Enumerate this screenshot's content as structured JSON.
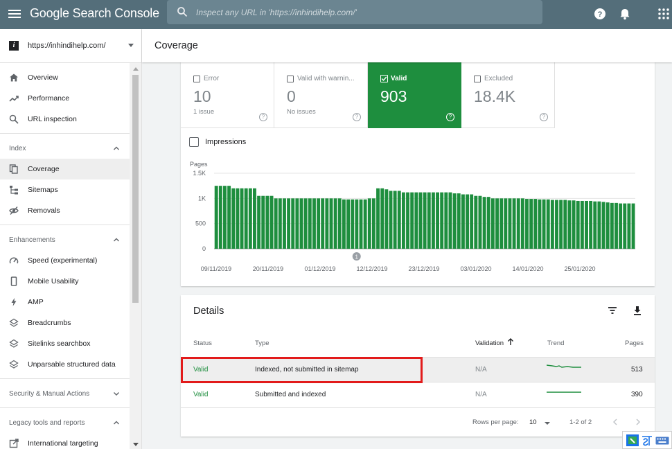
{
  "app": {
    "title": "Google Search Console",
    "search_placeholder": "Inspect any URL in 'https://inhindihelp.com/'"
  },
  "property": {
    "url": "https://inhindihelp.com/"
  },
  "nav": {
    "top": [
      {
        "label": "Overview",
        "icon": "home-icon"
      },
      {
        "label": "Performance",
        "icon": "trending-up-icon"
      },
      {
        "label": "URL inspection",
        "icon": "search-icon"
      }
    ],
    "index_label": "Index",
    "index": [
      {
        "label": "Coverage",
        "icon": "file-copy-icon"
      },
      {
        "label": "Sitemaps",
        "icon": "sitemap-icon"
      },
      {
        "label": "Removals",
        "icon": "eye-off-icon"
      }
    ],
    "enhancements_label": "Enhancements",
    "enhancements": [
      {
        "label": "Speed (experimental)",
        "icon": "speedometer-icon"
      },
      {
        "label": "Mobile Usability",
        "icon": "phone-icon"
      },
      {
        "label": "AMP",
        "icon": "bolt-icon"
      },
      {
        "label": "Breadcrumbs",
        "icon": "layers-icon"
      },
      {
        "label": "Sitelinks searchbox",
        "icon": "layers-icon"
      },
      {
        "label": "Unparsable structured data",
        "icon": "layers-icon"
      }
    ],
    "security_label": "Security & Manual Actions",
    "legacy_label": "Legacy tools and reports",
    "legacy": [
      {
        "label": "International targeting",
        "icon": "external-link-icon"
      }
    ]
  },
  "page": {
    "title": "Coverage"
  },
  "summary": {
    "tiles": [
      {
        "label": "Error",
        "value": "10",
        "sub": "1 issue",
        "selected": false
      },
      {
        "label": "Valid with warnin...",
        "value": "0",
        "sub": "No issues",
        "selected": false
      },
      {
        "label": "Valid",
        "value": "903",
        "sub": "",
        "selected": true
      },
      {
        "label": "Excluded",
        "value": "18.4K",
        "sub": "",
        "selected": false
      }
    ],
    "impressions_label": "Impressions"
  },
  "chart_data": {
    "type": "bar",
    "ylabel": "Pages",
    "ylim": [
      0,
      1500
    ],
    "yticks": [
      "1.5K",
      "1K",
      "500",
      "0"
    ],
    "xticks": [
      "09/11/2019",
      "20/11/2019",
      "01/12/2019",
      "12/12/2019",
      "23/12/2019",
      "03/01/2020",
      "14/01/2020",
      "25/01/2020"
    ],
    "annotation": "1",
    "annotation_index": 33,
    "color": "#1e8e3e",
    "values": [
      1250,
      1250,
      1250,
      1250,
      1200,
      1200,
      1200,
      1200,
      1200,
      1200,
      1050,
      1050,
      1050,
      1050,
      1000,
      1000,
      1000,
      1000,
      1000,
      1000,
      1000,
      1000,
      1000,
      1000,
      1000,
      1000,
      1000,
      1000,
      1000,
      1000,
      980,
      980,
      980,
      980,
      980,
      980,
      1000,
      1000,
      1200,
      1200,
      1180,
      1150,
      1150,
      1150,
      1120,
      1120,
      1120,
      1120,
      1120,
      1120,
      1120,
      1120,
      1120,
      1120,
      1120,
      1120,
      1100,
      1100,
      1080,
      1080,
      1080,
      1050,
      1050,
      1030,
      1030,
      1000,
      1000,
      1000,
      1000,
      1000,
      1000,
      1000,
      1000,
      990,
      990,
      990,
      980,
      980,
      980,
      970,
      970,
      970,
      970,
      960,
      960,
      950,
      950,
      950,
      950,
      940,
      940,
      930,
      920,
      910,
      910,
      900,
      900,
      900,
      900
    ]
  },
  "details": {
    "title": "Details",
    "columns": {
      "status": "Status",
      "type": "Type",
      "validation": "Validation",
      "trend": "Trend",
      "pages": "Pages"
    },
    "rows": [
      {
        "status": "Valid",
        "type": "Indexed, not submitted in sitemap",
        "validation": "N/A",
        "pages": "513"
      },
      {
        "status": "Valid",
        "type": "Submitted and indexed",
        "validation": "N/A",
        "pages": "390"
      }
    ],
    "rows_per_page_label": "Rows per page:",
    "rows_per_page": "10",
    "range": "1-2 of 2"
  },
  "colors": {
    "appbar": "#546e7a",
    "valid_green": "#1e8e3e",
    "highlight": "#e21b1b"
  }
}
